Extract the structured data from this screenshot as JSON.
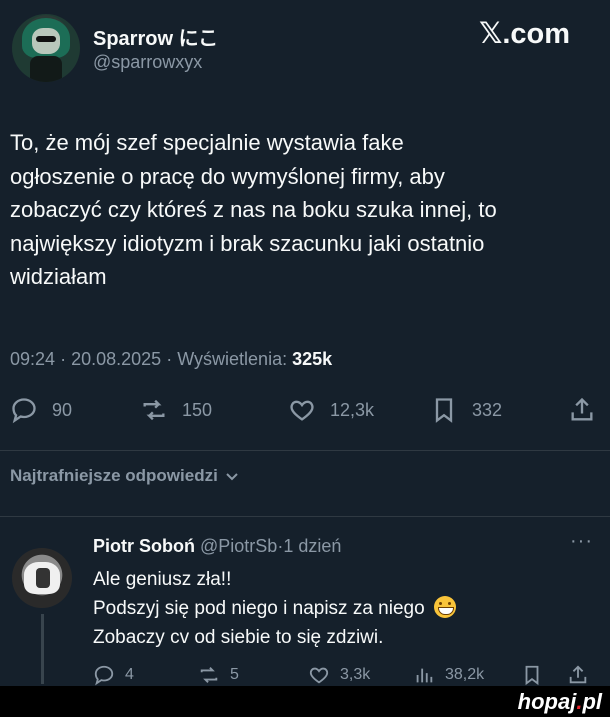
{
  "author": {
    "name": "Sparrow にこ",
    "handle": "@sparrowxyx"
  },
  "brand": {
    "x": "𝕏",
    "rest": ".com"
  },
  "tweet": {
    "text_lines": [
      "To, że mój szef specjalnie wystawia fake",
      "ogłoszenie o pracę do wymyślonej firmy, aby",
      "zobaczyć czy któreś z nas na boku szuka innej, to",
      "największy idiotyzm i brak szacunku jaki ostatnio",
      "widziałam"
    ],
    "time": "09:24",
    "date": "20.08.2025",
    "views_label": "Wyświetlenia:",
    "views_count": "325k",
    "sep": "·"
  },
  "actions": {
    "replies": "90",
    "reposts": "150",
    "likes": "12,3k",
    "bookmarks": "332",
    "icons": [
      "reply-icon",
      "repost-icon",
      "like-icon",
      "bookmark-icon",
      "share-icon"
    ]
  },
  "replies_sort": {
    "label": "Najtrafniejsze odpowiedzi"
  },
  "reply": {
    "name": "Piotr Soboń",
    "handle": "@PiotrSb",
    "age": "1 dzień",
    "more": "···",
    "lines": [
      "Ale geniusz zła!!",
      "Podszyj się pod niego i napisz za niego",
      "Zobaczy cv od siebie to się zdziwi."
    ],
    "emoji": "grinning-face-emoji",
    "stats": {
      "replies": "4",
      "reposts": "5",
      "likes": "3,3k",
      "views": "38,2k"
    }
  },
  "footer": {
    "logo_main": "hopaj",
    "logo_dot": ".",
    "logo_tld": "pl"
  },
  "colors": {
    "background": "#15202b",
    "text": "#f7f9f9",
    "muted": "#8b98a5",
    "footer": "#000000",
    "logo_dot": "#e8232b"
  }
}
